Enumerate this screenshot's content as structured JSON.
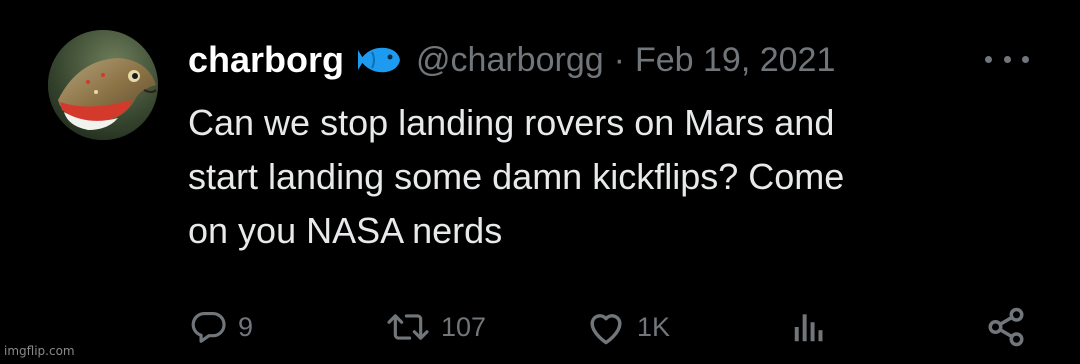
{
  "tweet": {
    "display_name": "charborg",
    "badge_icon": "fish-emoji-icon",
    "handle": "@charborgg",
    "separator": "·",
    "date": "Feb 19, 2021",
    "more_icon": "more-horizontal-icon",
    "lines": [
      "Can we stop landing rovers on Mars and",
      "start landing some damn kickflips? Come",
      "on you NASA nerds"
    ]
  },
  "actions": {
    "reply": {
      "icon": "reply-icon",
      "count": "9"
    },
    "retweet": {
      "icon": "retweet-icon",
      "count": "107"
    },
    "like": {
      "icon": "heart-icon",
      "count": "1K"
    },
    "views": {
      "icon": "analytics-icon"
    },
    "share": {
      "icon": "share-icon"
    }
  },
  "colors": {
    "background": "#000000",
    "text": "#e7e9ea",
    "muted": "#71767b",
    "name": "#ffffff",
    "badge": "#1d9bf0"
  },
  "watermark": "imgflip.com"
}
